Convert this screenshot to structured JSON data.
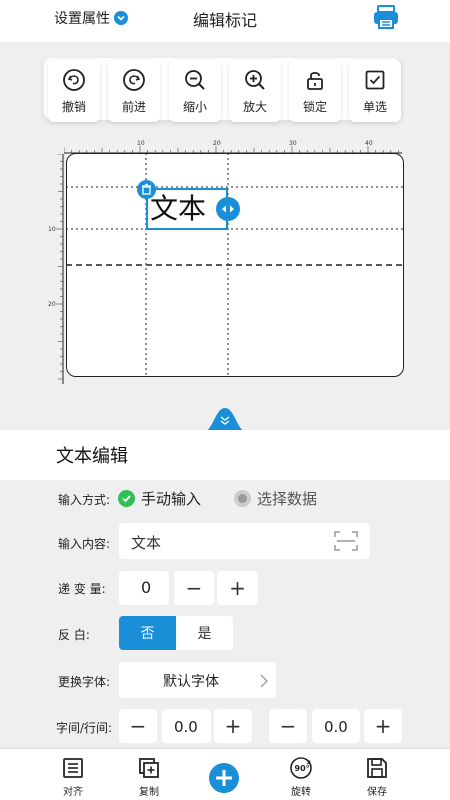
{
  "header": {
    "settings_label": "设置属性",
    "title": "编辑标记",
    "accent": "#1a8fd8"
  },
  "toolbar": {
    "items": [
      {
        "label": "撤销",
        "icon": "undo-icon"
      },
      {
        "label": "前进",
        "icon": "redo-icon"
      },
      {
        "label": "缩小",
        "icon": "zoom-out-icon"
      },
      {
        "label": "放大",
        "icon": "zoom-in-icon"
      },
      {
        "label": "锁定",
        "icon": "lock-icon"
      },
      {
        "label": "单选",
        "icon": "checkbox-icon"
      }
    ]
  },
  "ruler": {
    "top_ticks": [
      "10",
      "20",
      "30",
      "40"
    ],
    "left_ticks": [
      "10",
      "20"
    ]
  },
  "canvas": {
    "text_object": "文本"
  },
  "panel": {
    "title": "文本编辑",
    "input_mode": {
      "label": "输入方式:",
      "option_manual": "手动输入",
      "option_data": "选择数据",
      "selected": "手动输入"
    },
    "content": {
      "label": "输入内容:",
      "value": "文本"
    },
    "increment": {
      "label": "递 变 量:",
      "value": "0",
      "minus": "−",
      "plus": "+"
    },
    "invert": {
      "label": "反     白:",
      "off": "否",
      "on": "是",
      "selected": "否"
    },
    "font": {
      "label": "更换字体:",
      "value": "默认字体"
    },
    "spacing": {
      "label": "字间/行间:",
      "char_value": "0.0",
      "line_value": "0.0",
      "minus": "−",
      "plus": "+"
    }
  },
  "bottom_bar": {
    "items": [
      {
        "label": "对齐",
        "icon": "align-icon"
      },
      {
        "label": "复制",
        "icon": "copy-icon"
      },
      {
        "label": "",
        "icon": "add-icon"
      },
      {
        "label": "旋转",
        "icon": "rotate-90-icon"
      },
      {
        "label": "保存",
        "icon": "save-icon"
      }
    ]
  }
}
